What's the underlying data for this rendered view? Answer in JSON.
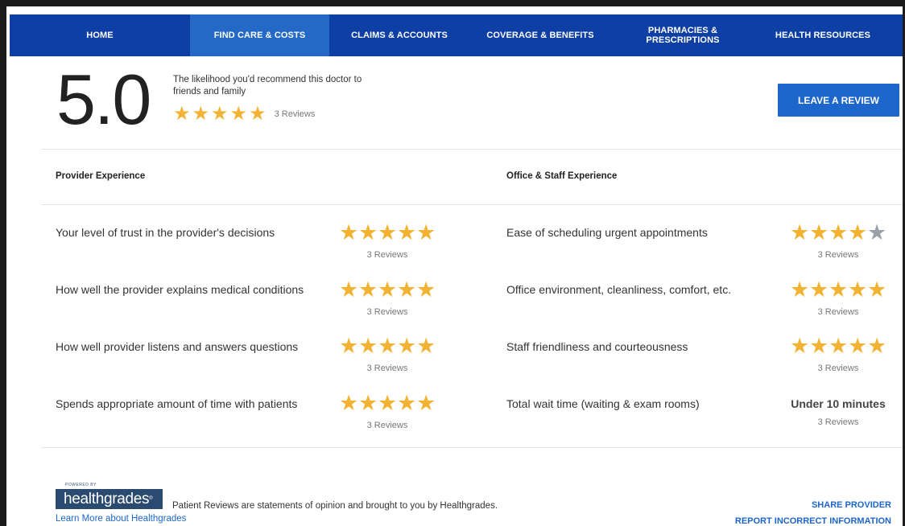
{
  "nav": {
    "items": [
      {
        "label": "HOME",
        "active": false
      },
      {
        "label": "FIND CARE & COSTS",
        "active": true
      },
      {
        "label": "CLAIMS & ACCOUNTS",
        "active": false
      },
      {
        "label": "COVERAGE & BENEFITS",
        "active": false
      },
      {
        "label": "PHARMACIES &\nPRESCRIPTIONS",
        "active": false
      },
      {
        "label": "HEALTH RESOURCES",
        "active": false
      }
    ]
  },
  "summary": {
    "score": "5.0",
    "likelihood_text": "The likelihood you'd recommend this doctor to friends and family",
    "rating": 5,
    "review_count": "3 Reviews",
    "leave_review_label": "LEAVE A REVIEW"
  },
  "sections": {
    "provider_title": "Provider Experience",
    "office_title": "Office & Staff Experience"
  },
  "provider_rows": [
    {
      "label": "Your level of trust in the provider's decisions",
      "rating": 5,
      "count": "3 Reviews"
    },
    {
      "label": "How well the provider explains medical conditions",
      "rating": 5,
      "count": "3 Reviews"
    },
    {
      "label": "How well provider listens and answers questions",
      "rating": 5,
      "count": "3 Reviews"
    },
    {
      "label": "Spends appropriate amount of time with patients",
      "rating": 5,
      "count": "3 Reviews"
    }
  ],
  "office_rows": [
    {
      "label": "Ease of scheduling urgent appointments",
      "rating": 4,
      "count": "3 Reviews"
    },
    {
      "label": "Office environment, cleanliness, comfort, etc.",
      "rating": 5,
      "count": "3 Reviews"
    },
    {
      "label": "Staff friendliness and courteousness",
      "rating": 5,
      "count": "3 Reviews"
    },
    {
      "label": "Total wait time (waiting & exam rooms)",
      "value_text": "Under 10 minutes",
      "count": "3 Reviews"
    }
  ],
  "footer": {
    "powered_by": "POWERED BY",
    "logo_text": "healthgrades",
    "learn_more": "Learn More about Healthgrades",
    "disclaimer": "Patient Reviews are statements of opinion and brought to you by Healthgrades.",
    "share_provider": "SHARE PROVIDER",
    "report_incorrect": "REPORT INCORRECT INFORMATION"
  },
  "colors": {
    "nav_bg": "#0e3fa5",
    "nav_active": "#2569c6",
    "star_filled": "#f2b233",
    "star_empty": "#9aa0a8",
    "link": "#1d66cb"
  },
  "icons": {
    "star": "star-icon",
    "star_empty": "star-empty-icon"
  }
}
